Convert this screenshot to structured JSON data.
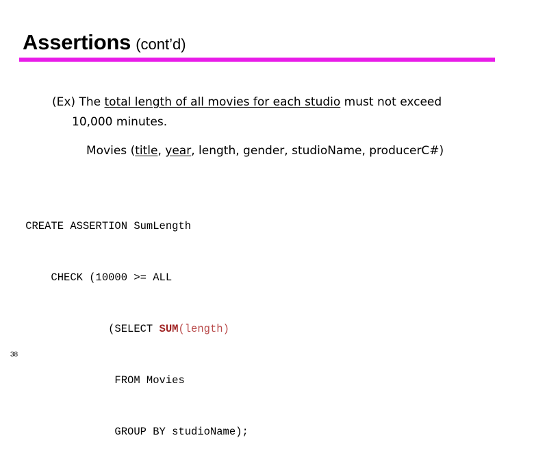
{
  "slide": {
    "title": {
      "main": "Assertions",
      "sub": "(cont’d)"
    },
    "rule_color": "#e81ce8",
    "body": {
      "example_line1_prefix": "(Ex) The ",
      "example_line1_underlined": "total length of all movies for each studio",
      "example_line1_suffix": " must not exceed",
      "example_line2": "10,000 minutes.",
      "schema_prefix": "Movies (",
      "schema_key1": "title",
      "schema_sep1": ", ",
      "schema_key2": "year",
      "schema_suffix": ", length, gender, studioName, producerC#)"
    },
    "code": {
      "line1": "    CREATE ASSERTION SumLength",
      "line2": "        CHECK (10000 >= ALL",
      "line3_prefix": "                 (SELECT ",
      "line3_function": "SUM",
      "line3_argument": "(length)",
      "line4": "                  FROM Movies",
      "line5": "                  GROUP BY studioName);",
      "function_color": "#a02323",
      "argument_color": "#b94a4a"
    },
    "page_number": "38"
  }
}
